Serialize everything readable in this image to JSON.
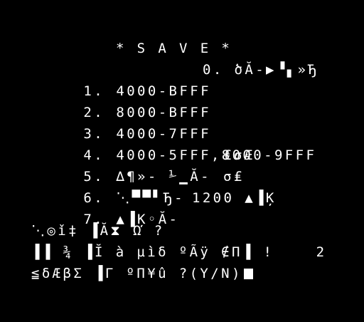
{
  "screen": {
    "title": "* S A V E *",
    "colors": {
      "background": "#000000",
      "text": "#ffffff"
    },
    "menu": [
      {
        "number": "1.",
        "text": "4000-BFFF",
        "extra": "0. ծĂ-▶▝▖»Ђ"
      },
      {
        "number": "2.",
        "text": "8000-BFFF",
        "extra": ""
      },
      {
        "number": "3.",
        "text": "4000-7FFF",
        "extra": ""
      },
      {
        "number": "4.",
        "text": "4000-5FFF,8000-9FFF",
        "extra": ""
      },
      {
        "number": "5.",
        "text": "∆¶»- ⅟▁Ă-",
        "extra": "₤σÆ"
      },
      {
        "number": "6.",
        "text": "⋱▀▀▘Ђ-",
        "extra": "σ₤"
      },
      {
        "number": "7.",
        "text": "▲▐Ķ◦Ă-",
        "extra": "1200 ▲▐Ķ"
      }
    ],
    "prompt_lines": [
      "⋱◎ǐ‡ ▐Ă⧗ Ω ?",
      "▐▐ ¾ ▐Ĭ à µìδ ºÃÿ ∉Π▐ !    2",
      "≦δÆβΣ ▐Γ ºΠ¥û ?(Y/N)"
    ],
    "cursor_icon": "block-cursor"
  }
}
